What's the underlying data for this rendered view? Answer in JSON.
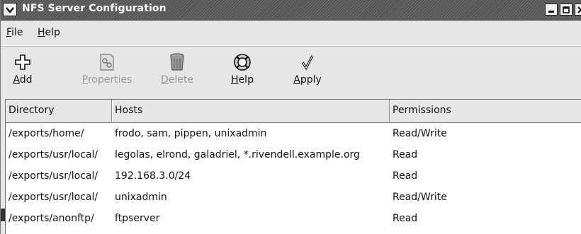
{
  "window": {
    "title": "NFS Server Configuration"
  },
  "menubar": {
    "items": [
      {
        "label": "File",
        "mnemonic": "F",
        "rest": "ile"
      },
      {
        "label": "Help",
        "mnemonic": "H",
        "rest": "elp"
      }
    ]
  },
  "toolbar": {
    "buttons": [
      {
        "label": "Add",
        "mnemonic": "A",
        "rest": "dd",
        "icon": "add-icon",
        "enabled": true
      },
      {
        "label": "Properties",
        "mnemonic": "P",
        "rest": "roperties",
        "icon": "properties-icon",
        "enabled": false
      },
      {
        "label": "Delete",
        "mnemonic": "D",
        "rest": "elete",
        "icon": "delete-icon",
        "enabled": false
      },
      {
        "label": "Help",
        "mnemonic": "H",
        "rest": "elp",
        "icon": "help-icon",
        "enabled": true
      },
      {
        "label": "Apply",
        "mnemonic": "A",
        "rest": "pply",
        "icon": "apply-icon",
        "enabled": true
      }
    ]
  },
  "table": {
    "columns": [
      "Directory",
      "Hosts",
      "Permissions"
    ],
    "rows": [
      {
        "directory": "/exports/home/",
        "hosts": "frodo, sam, pippen, unixadmin",
        "permissions": "Read/Write"
      },
      {
        "directory": "/exports/usr/local/",
        "hosts": "legolas, elrond, galadriel, *.rivendell.example.org",
        "permissions": "Read"
      },
      {
        "directory": "/exports/usr/local/",
        "hosts": "192.168.3.0/24",
        "permissions": "Read"
      },
      {
        "directory": "/exports/usr/local/",
        "hosts": "unixadmin",
        "permissions": "Read/Write"
      },
      {
        "directory": "/exports/anonftp/",
        "hosts": "ftpserver",
        "permissions": "Read"
      }
    ]
  },
  "colors": {
    "titlebar": "#5a5a5a",
    "chrome": "#e6e6e6",
    "disabled_text": "#9a9a9a"
  }
}
